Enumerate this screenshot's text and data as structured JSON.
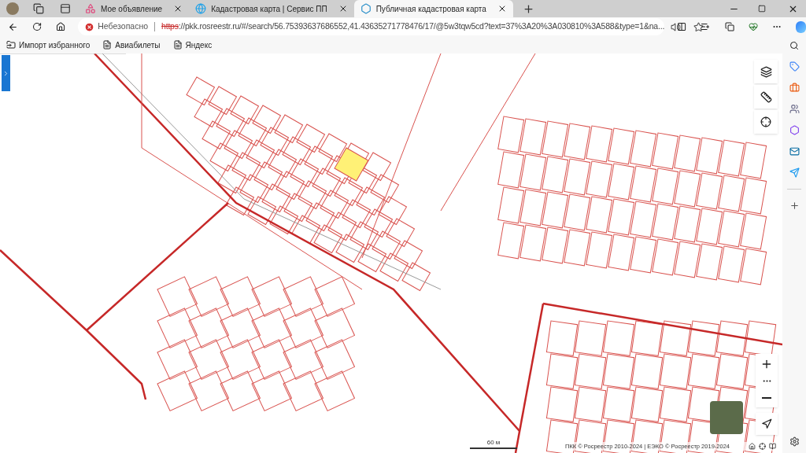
{
  "tabs": [
    {
      "title": "Мое объявление",
      "selected": false
    },
    {
      "title": "Кадастровая карта | Сервис ПП",
      "selected": false
    },
    {
      "title": "Публичная кадастровая карта",
      "selected": true
    }
  ],
  "address_bar": {
    "security": "Небезопасно",
    "url_scheme": "https",
    "url_rest": "://pkk.rosreestr.ru/#/search/56.75393637686552,41.43635271778476/17/@5w3tqw5cd?text=37%3A20%3A030810%3A588&type=1&na..."
  },
  "bookmarks": [
    {
      "label": "Импорт избранного",
      "kind": "import"
    },
    {
      "label": "Авиабилеты",
      "kind": "page"
    },
    {
      "label": "Яндекс",
      "kind": "page"
    }
  ],
  "map": {
    "scale": "60 м",
    "attribution": "ПКК © Росреестр 2010-2024 | ЕЭКО © Росреестр 2019-2024"
  }
}
